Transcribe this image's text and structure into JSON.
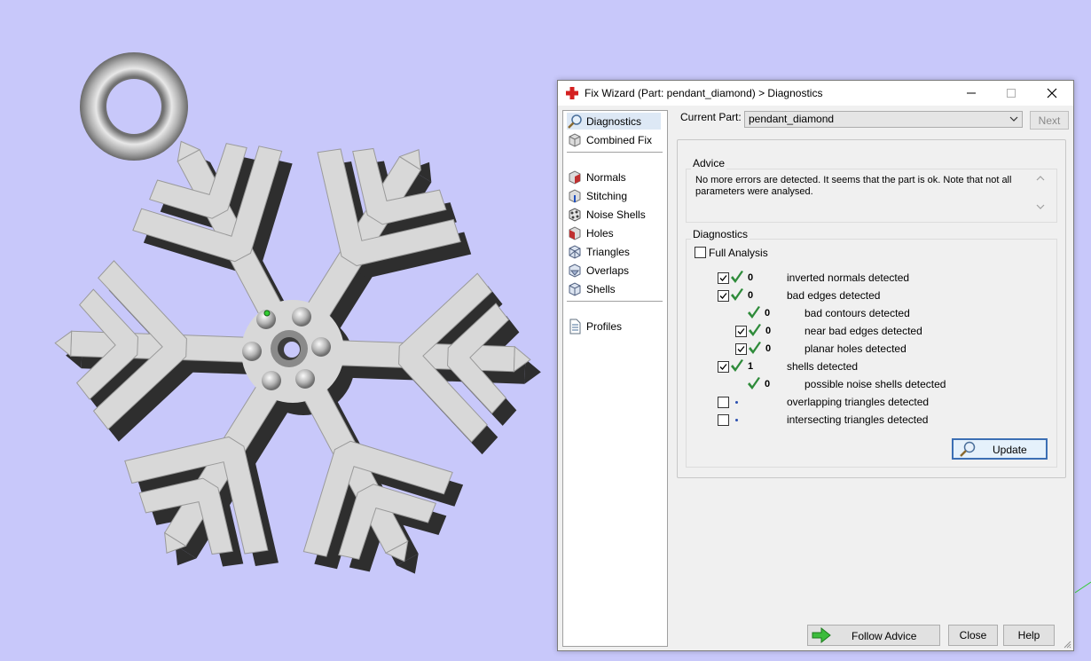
{
  "window": {
    "title": "Fix Wizard (Part: pendant_diamond) > Diagnostics"
  },
  "nav": {
    "top": [
      {
        "label": "Diagnostics",
        "icon": "magnifier-icon"
      },
      {
        "label": "Combined Fix",
        "icon": "cube-icon"
      }
    ],
    "fixes": [
      {
        "label": "Normals",
        "icon": "normals-cube-icon"
      },
      {
        "label": "Stitching",
        "icon": "stitching-cube-icon"
      },
      {
        "label": "Noise Shells",
        "icon": "noise-shells-icon"
      },
      {
        "label": "Holes",
        "icon": "holes-cube-icon"
      },
      {
        "label": "Triangles",
        "icon": "triangles-cube-icon"
      },
      {
        "label": "Overlaps",
        "icon": "overlaps-cube-icon"
      },
      {
        "label": "Shells",
        "icon": "shells-cube-icon"
      }
    ],
    "bottom": [
      {
        "label": "Profiles",
        "icon": "document-icon"
      }
    ]
  },
  "current_part": {
    "label": "Current Part:",
    "value": "pendant_diamond"
  },
  "next_label": "Next",
  "advice": {
    "title": "Advice",
    "text": "No more errors are detected. It seems that the part is ok. Note that not all parameters were analysed."
  },
  "diagnostics": {
    "title": "Diagnostics",
    "full_analysis_label": "Full Analysis",
    "rows": [
      {
        "checkbox": true,
        "checked": true,
        "status": "ok",
        "count": "0",
        "label": "inverted normals detected"
      },
      {
        "checkbox": true,
        "checked": true,
        "status": "ok",
        "count": "0",
        "label": "bad edges detected"
      },
      {
        "checkbox": false,
        "checked": false,
        "status": "ok",
        "count": "0",
        "label": "bad contours detected"
      },
      {
        "checkbox": true,
        "checked": true,
        "status": "ok",
        "count": "0",
        "label": "near bad edges detected"
      },
      {
        "checkbox": true,
        "checked": true,
        "status": "ok",
        "count": "0",
        "label": "planar holes detected"
      },
      {
        "checkbox": true,
        "checked": true,
        "status": "ok",
        "count": "1",
        "label": "shells detected"
      },
      {
        "checkbox": false,
        "checked": false,
        "status": "ok",
        "count": "0",
        "label": "possible noise shells detected"
      },
      {
        "checkbox": true,
        "checked": false,
        "status": "not-analysed",
        "count": "",
        "label": "overlapping triangles detected"
      },
      {
        "checkbox": true,
        "checked": false,
        "status": "not-analysed",
        "count": "",
        "label": "intersecting triangles detected"
      }
    ]
  },
  "buttons": {
    "update": "Update",
    "follow_advice": "Follow Advice",
    "close": "Close",
    "help": "Help"
  },
  "colors": {
    "viewport_background": "#c8c8fa",
    "part_surface": "#d8d8d8",
    "check_green": "#2e8b3a",
    "accent_blue": "#3c6fb4"
  }
}
